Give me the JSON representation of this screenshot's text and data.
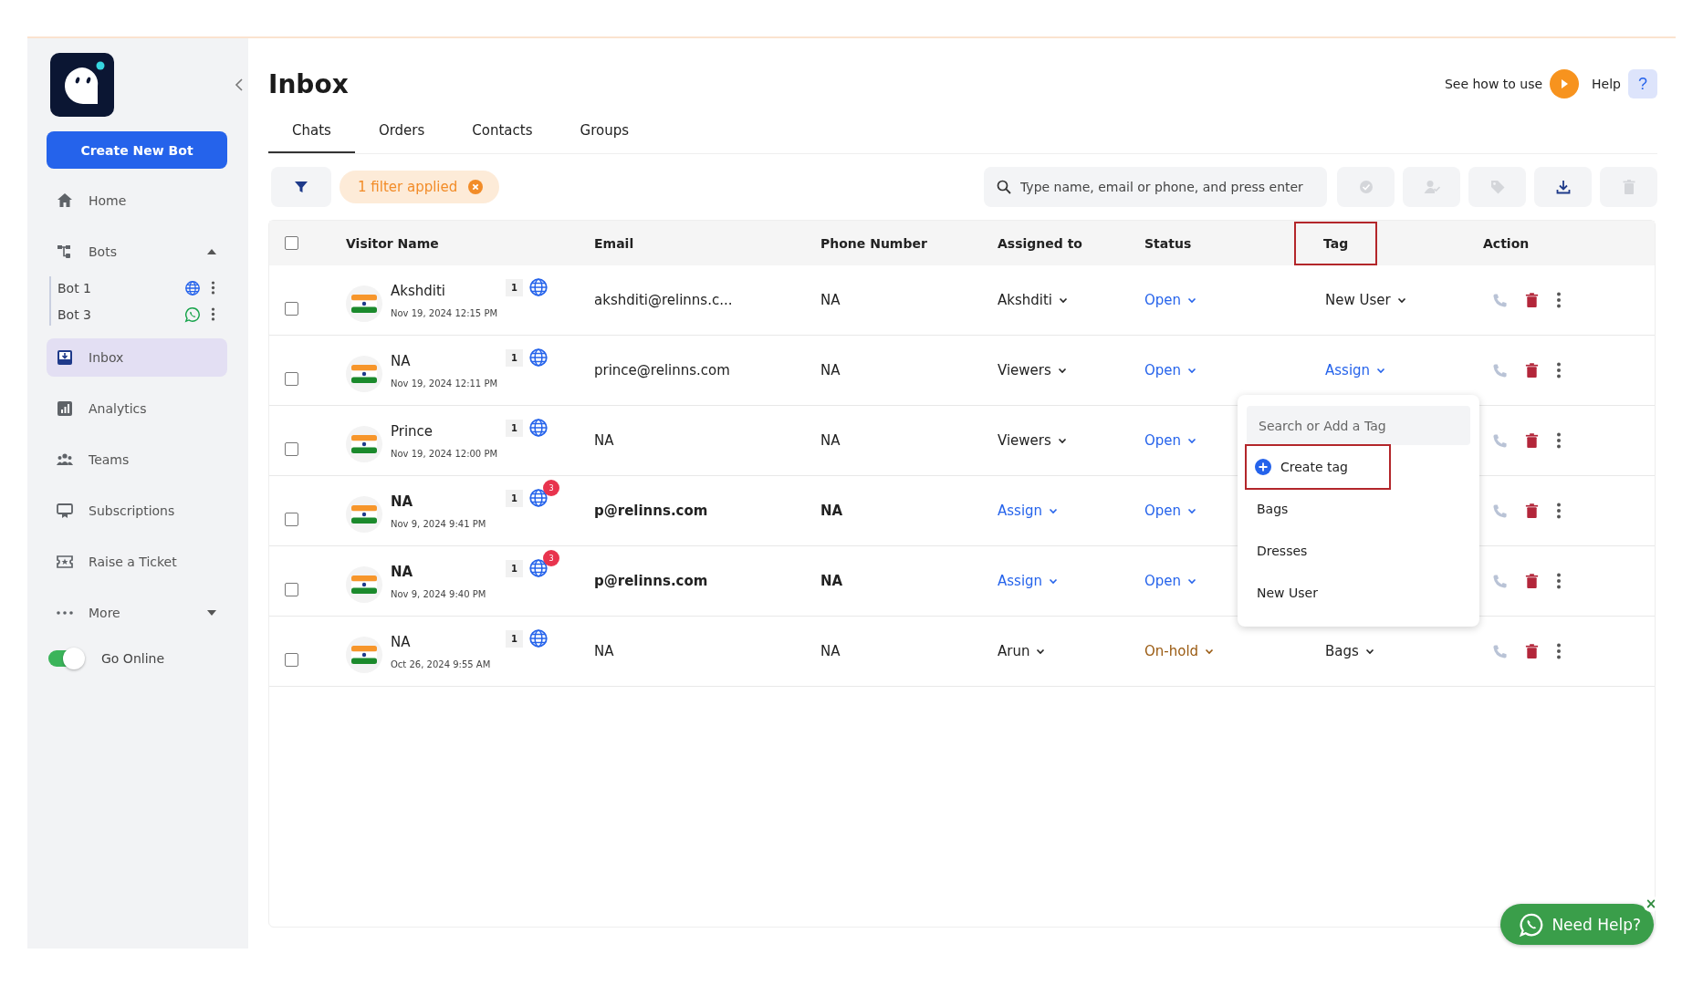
{
  "sidebar": {
    "create_button": "Create New Bot",
    "items": [
      {
        "kind": "home",
        "label": "Home",
        "selected": false
      },
      {
        "kind": "bots",
        "label": "Bots",
        "selected": false,
        "expanded": true,
        "children": [
          {
            "label": "Bot 1",
            "kind": "web"
          },
          {
            "label": "Bot 3",
            "kind": "whatsapp"
          }
        ]
      },
      {
        "kind": "inbox",
        "label": "Inbox",
        "selected": true
      },
      {
        "kind": "analytics",
        "label": "Analytics",
        "selected": false
      },
      {
        "kind": "teams",
        "label": "Teams",
        "selected": false
      },
      {
        "kind": "subscriptions",
        "label": "Subscriptions",
        "selected": false
      },
      {
        "kind": "ticket",
        "label": "Raise a Ticket",
        "selected": false
      },
      {
        "kind": "more",
        "label": "More",
        "selected": false,
        "expanded": false
      }
    ],
    "online_toggle": {
      "label": "Go Online",
      "on": true
    }
  },
  "header": {
    "title": "Inbox",
    "how_to": "See how to use",
    "help": "Help",
    "help_icon": "?"
  },
  "tabs": [
    {
      "label": "Chats",
      "selected": true
    },
    {
      "label": "Orders",
      "selected": false
    },
    {
      "label": "Contacts",
      "selected": false
    },
    {
      "label": "Groups",
      "selected": false
    }
  ],
  "toolbar": {
    "filter_chip": "1 filter applied",
    "search": {
      "placeholder": "Type name, email or phone, and press enter"
    },
    "actions": [
      {
        "kind": "resolve",
        "disabled": true
      },
      {
        "kind": "assign",
        "disabled": true
      },
      {
        "kind": "tag",
        "disabled": true
      },
      {
        "kind": "download",
        "disabled": false
      },
      {
        "kind": "delete",
        "disabled": true
      }
    ]
  },
  "table": {
    "select_all": {
      "checked": false
    },
    "columns": [
      {
        "label": "Visitor Name",
        "highlighted": false
      },
      {
        "label": "Email",
        "highlighted": false
      },
      {
        "label": "Phone Number",
        "highlighted": false
      },
      {
        "label": "Assigned to",
        "highlighted": false
      },
      {
        "label": "Status",
        "highlighted": false
      },
      {
        "label": "Tag",
        "highlighted": true
      },
      {
        "label": "Action",
        "highlighted": false
      }
    ],
    "rows": [
      {
        "checked": false,
        "unread": false,
        "name": "Akshditi",
        "time": "Nov 19, 2024 12:15 PM",
        "count": "1",
        "badge": null,
        "email": "akshditi@relinns.c...",
        "phone": "NA",
        "assigned": {
          "kind": "user",
          "text": "Akshditi"
        },
        "status": {
          "kind": "open",
          "text": "Open"
        },
        "tag": {
          "kind": "set",
          "text": "New User"
        }
      },
      {
        "checked": false,
        "unread": false,
        "name": "NA",
        "time": "Nov 19, 2024 12:11 PM",
        "count": "1",
        "badge": null,
        "email": "prince@relinns.com",
        "phone": "NA",
        "assigned": {
          "kind": "user",
          "text": "Viewers"
        },
        "status": {
          "kind": "open",
          "text": "Open"
        },
        "tag": {
          "kind": "assign",
          "text": "Assign",
          "menu_open": true
        }
      },
      {
        "checked": false,
        "unread": false,
        "name": "Prince",
        "time": "Nov 19, 2024 12:00 PM",
        "count": "1",
        "badge": null,
        "email": "NA",
        "phone": "NA",
        "assigned": {
          "kind": "user",
          "text": "Viewers"
        },
        "status": {
          "kind": "open",
          "text": "Open"
        }
      },
      {
        "checked": false,
        "unread": true,
        "name": "NA",
        "time": "Nov 9, 2024 9:41 PM",
        "count": "1",
        "badge": "3",
        "email": "p@relinns.com",
        "phone": "NA",
        "assigned": {
          "kind": "assign",
          "text": "Assign"
        },
        "status": {
          "kind": "open",
          "text": "Open"
        }
      },
      {
        "checked": false,
        "unread": true,
        "name": "NA",
        "time": "Nov 9, 2024 9:40 PM",
        "count": "1",
        "badge": "3",
        "email": "p@relinns.com",
        "phone": "NA",
        "assigned": {
          "kind": "assign",
          "text": "Assign"
        },
        "status": {
          "kind": "open",
          "text": "Open"
        }
      },
      {
        "checked": false,
        "unread": false,
        "name": "NA",
        "time": "Oct 26, 2024 9:55 AM",
        "count": "1",
        "badge": null,
        "email": "NA",
        "phone": "NA",
        "assigned": {
          "kind": "user",
          "text": "Arun"
        },
        "status": {
          "kind": "on-hold",
          "text": "On-hold"
        },
        "tag": {
          "kind": "set",
          "text": "Bags"
        }
      }
    ]
  },
  "tag_menu": {
    "search": {
      "placeholder": "Search or Add a Tag"
    },
    "create": {
      "label": "Create tag",
      "highlighted": true
    },
    "options": [
      "Bags",
      "Dresses",
      "New User"
    ]
  },
  "help_widget": {
    "label": "Need Help?",
    "close": "×"
  }
}
